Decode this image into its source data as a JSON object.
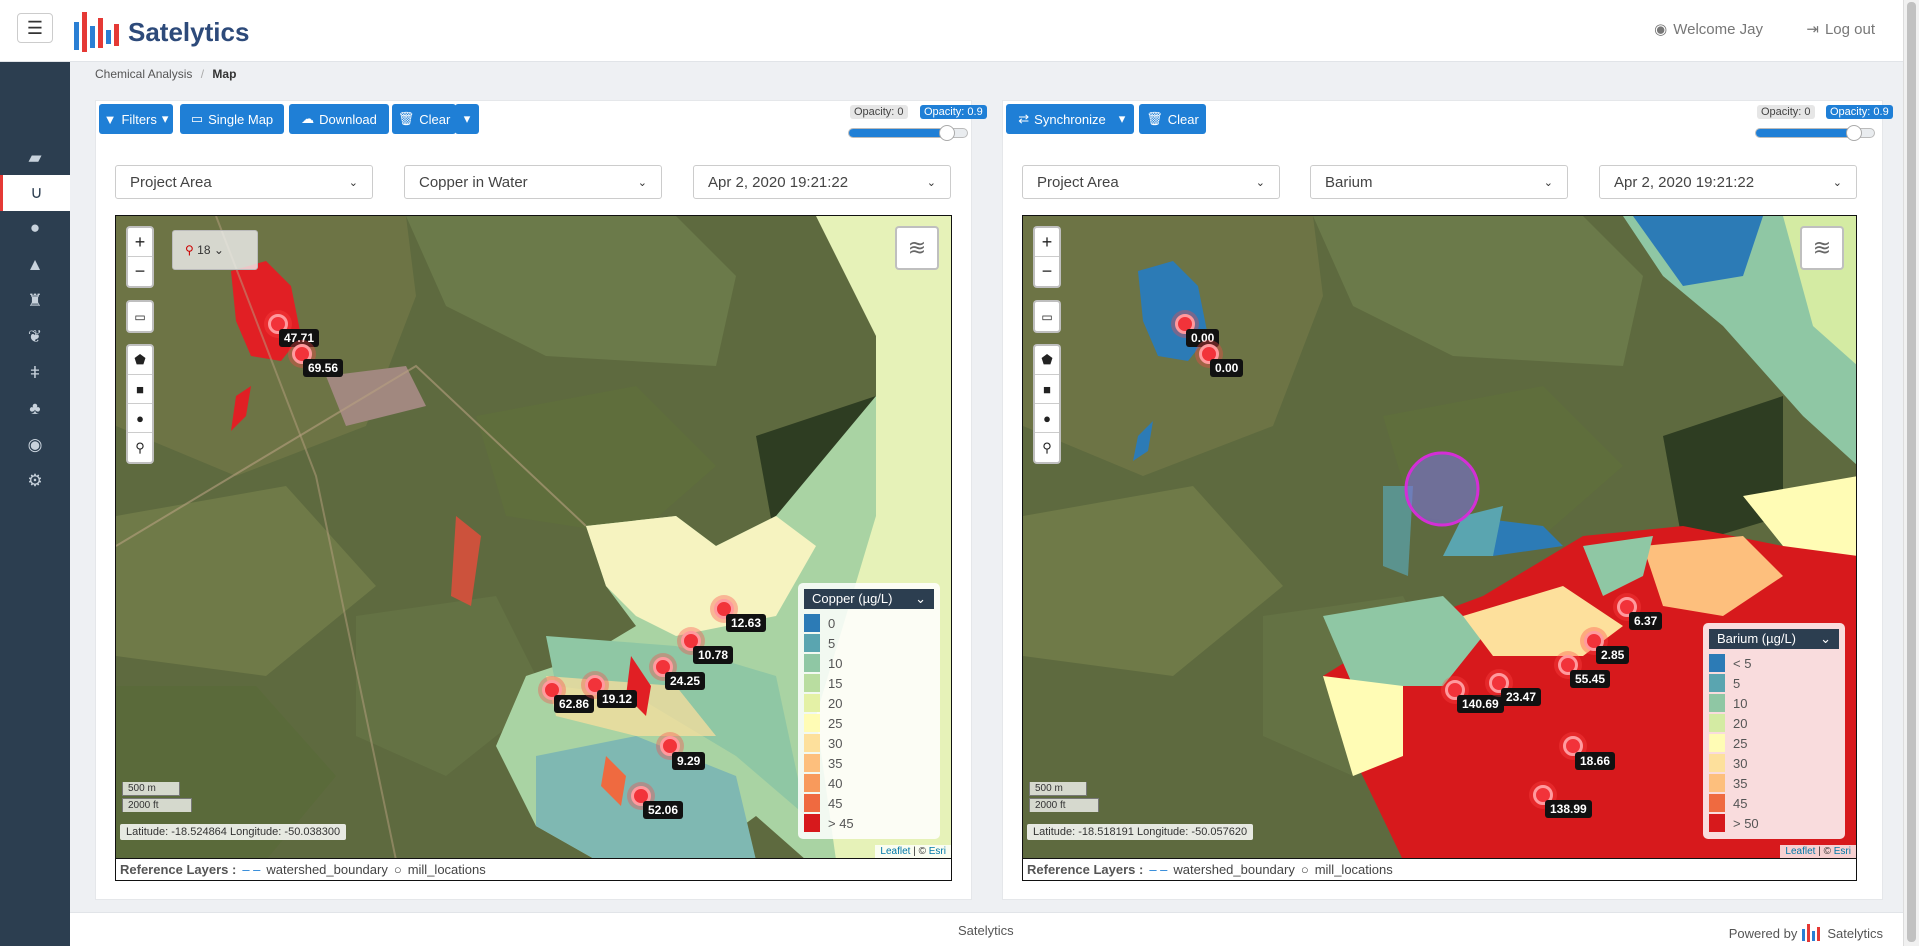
{
  "header": {
    "app_name": "Satelytics",
    "welcome": "Welcome Jay",
    "logout": "Log out"
  },
  "breadcrumb": {
    "parent": "Chemical Analysis",
    "separator": "/",
    "current": "Map"
  },
  "left_toolbar": {
    "filters": "Filters",
    "single_map": "Single Map",
    "download": "Download",
    "clear": "Clear"
  },
  "right_toolbar": {
    "synchronize": "Synchronize",
    "clear": "Clear"
  },
  "opacity": {
    "min_label": "Opacity: 0",
    "max_label": "Opacity: 0.9",
    "value": 0.9
  },
  "left_map": {
    "area": "Project Area",
    "parameter": "Copper in Water",
    "date": "Apr 2, 2020 19:21:22",
    "pin_count": "18",
    "legend_title": "Copper (µg/L)",
    "legend": [
      {
        "label": "0",
        "color": "#2c7bb6"
      },
      {
        "label": "5",
        "color": "#5aa5b0"
      },
      {
        "label": "10",
        "color": "#8fc7a4"
      },
      {
        "label": "15",
        "color": "#b9dda0"
      },
      {
        "label": "20",
        "color": "#e4f1a6"
      },
      {
        "label": "25",
        "color": "#fffcb5"
      },
      {
        "label": "30",
        "color": "#fde09c"
      },
      {
        "label": "35",
        "color": "#fdbf7d"
      },
      {
        "label": "40",
        "color": "#f89a5c"
      },
      {
        "label": "45",
        "color": "#ef6a40"
      },
      {
        "label": "> 45",
        "color": "#d7191c"
      }
    ],
    "markers": [
      "47.71",
      "69.56",
      "12.63",
      "10.78",
      "24.25",
      "62.86",
      "19.12",
      "9.29",
      "52.06"
    ],
    "scale_m": "500 m",
    "scale_ft": "2000 ft",
    "coords": "Latitude: -18.524864 Longitude: -50.038300"
  },
  "right_map": {
    "area": "Project Area",
    "parameter": "Barium",
    "date": "Apr 2, 2020 19:21:22",
    "legend_title": "Barium (µg/L)",
    "legend": [
      {
        "label": "< 5",
        "color": "#2c7bb6"
      },
      {
        "label": "5",
        "color": "#5aa5b0"
      },
      {
        "label": "10",
        "color": "#8fc7a4"
      },
      {
        "label": "20",
        "color": "#d4eba3"
      },
      {
        "label": "25",
        "color": "#fffcb5"
      },
      {
        "label": "30",
        "color": "#fde09c"
      },
      {
        "label": "35",
        "color": "#fdbf7d"
      },
      {
        "label": "45",
        "color": "#ef6a40"
      },
      {
        "label": "> 50",
        "color": "#d7191c"
      }
    ],
    "markers": [
      "0.00",
      "0.00",
      "6.37",
      "2.85",
      "55.45",
      "140.69",
      "23.47",
      "18.66",
      "138.99"
    ],
    "scale_m": "500 m",
    "scale_ft": "2000 ft",
    "coords": "Latitude: -18.518191 Longitude: -50.057620"
  },
  "attribution": {
    "leaflet": "Leaflet",
    "sep": " | © ",
    "esri": "Esri"
  },
  "reference_layers": {
    "label": "Reference Layers :",
    "watershed": "watershed_boundary",
    "mills": "mill_locations"
  },
  "footer": {
    "center": "Satelytics",
    "powered_by": "Powered by",
    "brand": "Satelytics"
  }
}
